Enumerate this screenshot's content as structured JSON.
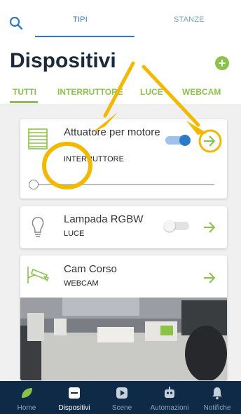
{
  "tabs": [
    {
      "label": "TIPI",
      "active": true
    },
    {
      "label": "STANZE",
      "active": false
    }
  ],
  "header": {
    "title": "Dispositivi",
    "filters": [
      "TUTTI",
      "INTERRUTTORE",
      "LUCE",
      "WEBCAM"
    ],
    "active_filter": "TUTTI"
  },
  "devices": [
    {
      "name": "Attuatore per motore",
      "type": "INTERRUTTORE",
      "icon": "shutter-icon",
      "switch_on": true,
      "level": 0
    },
    {
      "name": "Lampada RGBW",
      "type": "LUCE",
      "icon": "bulb-icon",
      "switch_on": false
    },
    {
      "name": "Cam Corso",
      "type": "WEBCAM",
      "icon": "camera-icon"
    }
  ],
  "bottom_nav": [
    {
      "label": "Home",
      "icon": "leaf-icon",
      "active": false
    },
    {
      "label": "Dispositivi",
      "icon": "devices-icon",
      "active": true
    },
    {
      "label": "Scene",
      "icon": "play-icon",
      "active": false
    },
    {
      "label": "Automazioni",
      "icon": "robot-icon",
      "active": false
    },
    {
      "label": "Notifiche",
      "icon": "bell-icon",
      "active": false
    }
  ],
  "colors": {
    "accent_green": "#8bc34a",
    "accent_blue": "#2a7cc8",
    "nav_bg": "#0e2a47",
    "annotation_orange": "#f5b800"
  }
}
